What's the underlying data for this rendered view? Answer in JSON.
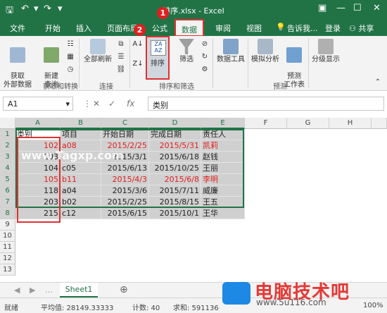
{
  "window": {
    "title": "排序.xlsx - Excel"
  },
  "ribbon_tabs": [
    "文件",
    "开始",
    "插入",
    "页面布局",
    "公式",
    "数据",
    "审阅",
    "视图"
  ],
  "tell_me": "告诉我...",
  "sign_in": "登录",
  "share": "共享",
  "ribbon": {
    "get_external": "获取\n外部数据",
    "new_query": "新建\n查询",
    "refresh_all": "全部刷新",
    "sort": "排序",
    "filter": "筛选",
    "data_tools": "数据工具",
    "what_if": "模拟分析",
    "forecast_sheet": "预测\n工作表",
    "outline": "分级显示",
    "group_get_transform": "获取和转换",
    "group_connections": "连接",
    "group_sort_filter": "排序和筛选",
    "group_forecast": "预测",
    "sort_az": "ZA\nAZ"
  },
  "markers": [
    "1",
    "2"
  ],
  "name_box": "A1",
  "formula_bar": {
    "fx": "fx",
    "value": "类别"
  },
  "columns": [
    "A",
    "B",
    "C",
    "D",
    "E",
    "F",
    "G",
    "H"
  ],
  "rows": [
    "1",
    "2",
    "3",
    "4",
    "5",
    "6",
    "7",
    "8",
    "9",
    "10",
    "11",
    "12",
    "13"
  ],
  "table": {
    "headers": [
      "类别",
      "项目",
      "开始日期",
      "完成日期",
      "责任人"
    ],
    "rows": [
      [
        "102",
        "a08",
        "2015/2/25",
        "2015/5/31",
        "凯莉"
      ],
      [
        "103",
        "",
        "2015/3/1",
        "2015/6/18",
        "赵钱"
      ],
      [
        "104",
        "c05",
        "2015/6/13",
        "2015/10/25",
        "王丽"
      ],
      [
        "105",
        "b11",
        "2015/4/3",
        "2015/6/8",
        "李明"
      ],
      [
        "118",
        "a04",
        "2015/3/6",
        "2015/7/11",
        "威廉"
      ],
      [
        "203",
        "b02",
        "2015/2/25",
        "2015/8/15",
        "王五"
      ],
      [
        "215",
        "c12",
        "2015/6/15",
        "2015/10/1",
        "王华"
      ]
    ],
    "red_rows": [
      0,
      3
    ]
  },
  "watermark": "www.Tagxp.com",
  "sheets": [
    "Sheet1"
  ],
  "status": {
    "ready": "就绪",
    "average": "平均值: 28149.33333",
    "count": "计数: 40",
    "sum": "求和: 591136",
    "zoom": "100%"
  },
  "site": {
    "brand": "电脑技术吧",
    "url": "www.5u116.com"
  }
}
